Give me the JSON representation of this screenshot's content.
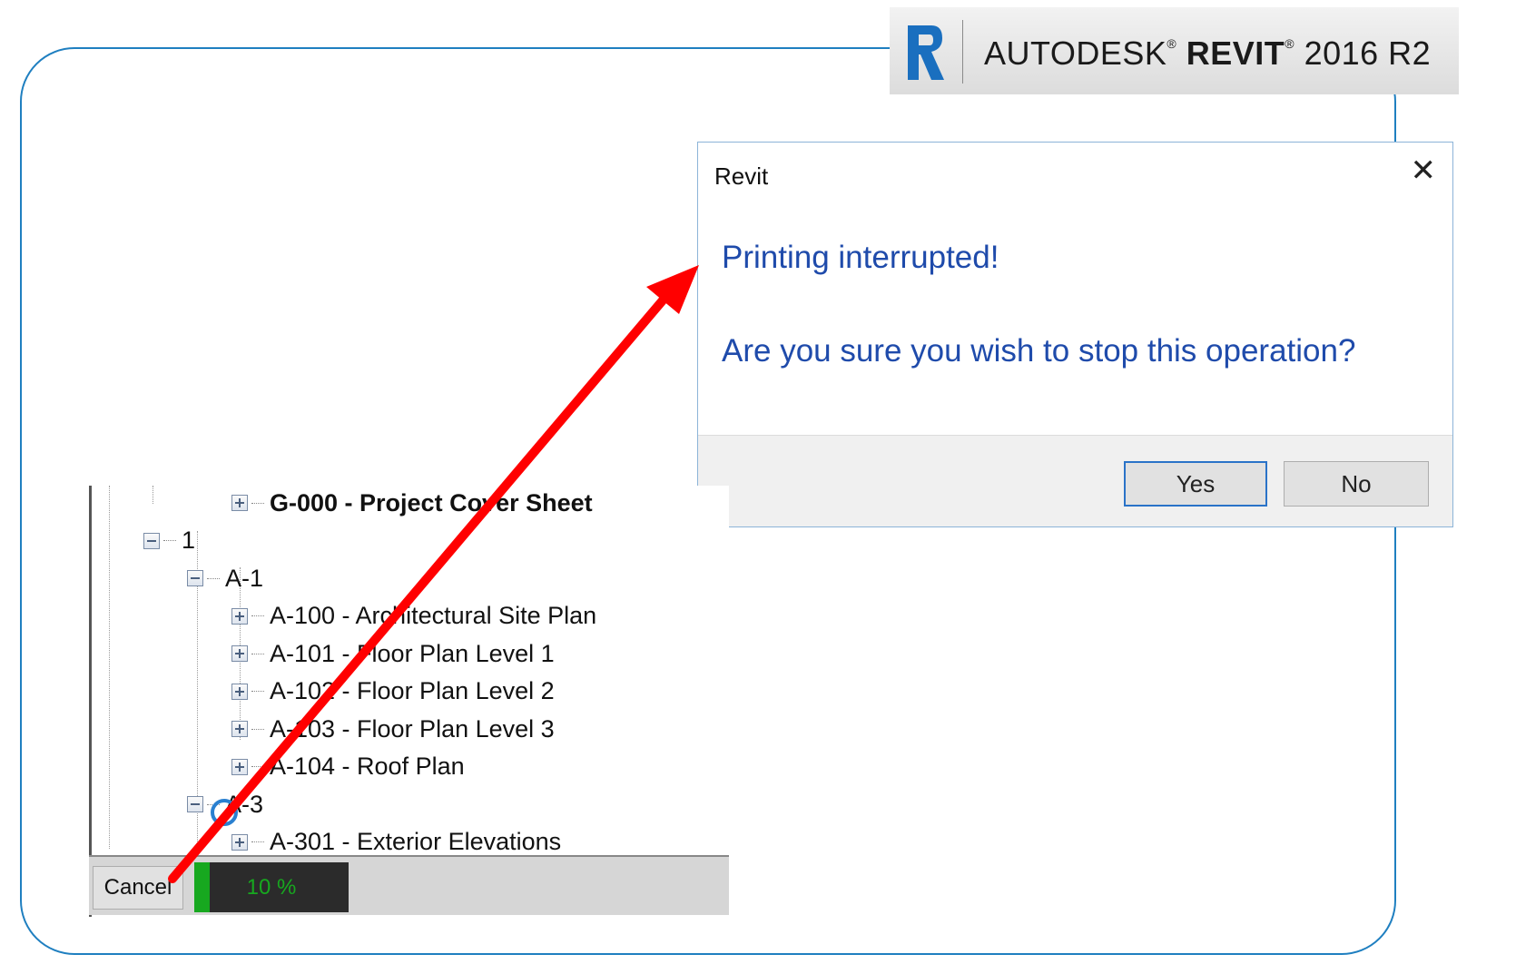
{
  "brand": {
    "company": "AUTODESK",
    "product": "REVIT",
    "version": "2016 R2",
    "reg_mark": "®",
    "logo_icon": "revit-r-logo-icon",
    "accent": "#1a6fbf"
  },
  "dialog": {
    "title": "Revit",
    "close_icon": "close-icon",
    "message_line1": "Printing interrupted!",
    "message_line2": "Are you sure you wish to stop this operation?",
    "yes_label": "Yes",
    "no_label": "No",
    "message_color": "#1f4bab"
  },
  "tree": {
    "items": [
      {
        "label": "G-000 - Project Cover Sheet",
        "level": 2,
        "toggle": "plus",
        "bold": true
      },
      {
        "label": "1",
        "level": 0,
        "toggle": "minus",
        "bold": false
      },
      {
        "label": "A-1",
        "level": 1,
        "toggle": "minus",
        "bold": false
      },
      {
        "label": "A-100 - Architectural Site Plan",
        "level": 2,
        "toggle": "plus",
        "bold": false
      },
      {
        "label": "A-101 - Floor Plan Level 1",
        "level": 2,
        "toggle": "plus",
        "bold": false
      },
      {
        "label": "A-102 - Floor Plan Level 2",
        "level": 2,
        "toggle": "plus",
        "bold": false
      },
      {
        "label": "A-103 - Floor Plan Level 3",
        "level": 2,
        "toggle": "plus",
        "bold": false
      },
      {
        "label": "A-104 - Roof Plan",
        "level": 2,
        "toggle": "plus",
        "bold": false
      },
      {
        "label": "A-3",
        "level": 1,
        "toggle": "minus",
        "bold": false
      },
      {
        "label": "A-301 - Exterior Elevations",
        "level": 2,
        "toggle": "plus",
        "bold": false
      }
    ]
  },
  "statusbar": {
    "cancel_label": "Cancel",
    "progress_text": "10 %",
    "progress_fraction": 0.1,
    "progress_color": "#17a81f"
  },
  "annotation": {
    "arrow_color": "#ff0000",
    "frame_color": "#1f7fc0"
  }
}
